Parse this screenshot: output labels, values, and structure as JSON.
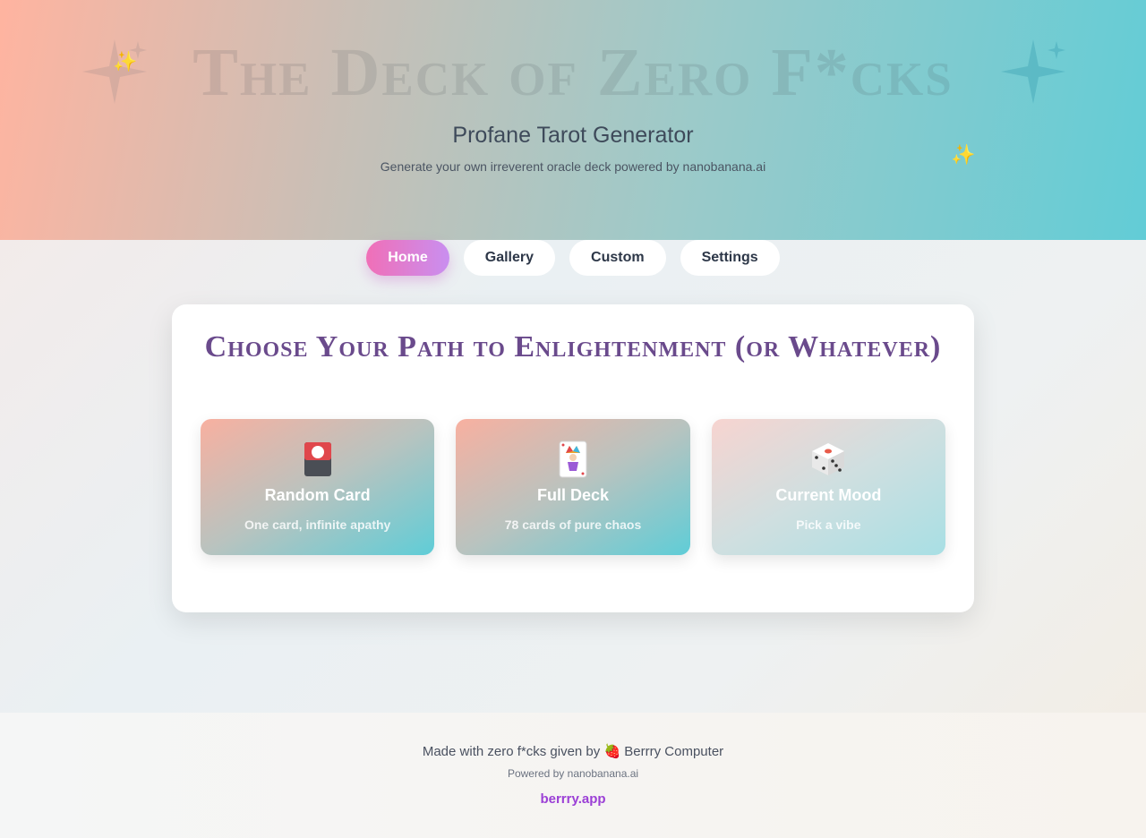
{
  "hero": {
    "title": "The Deck of Zero F*cks",
    "subtitle": "Profane Tarot Generator",
    "tagline": "Generate your own irreverent oracle deck powered by nanobanana.ai"
  },
  "nav": {
    "items": [
      {
        "label": "Home",
        "active": true
      },
      {
        "label": "Gallery",
        "active": false
      },
      {
        "label": "Custom",
        "active": false
      },
      {
        "label": "Settings",
        "active": false
      }
    ]
  },
  "main": {
    "heading": "Choose Your Path to Enlightenment (or Whatever)",
    "options": [
      {
        "title": "Random Card",
        "description": "One card, infinite apathy",
        "icon": "flower-card-icon"
      },
      {
        "title": "Full Deck",
        "description": "78 cards of pure chaos",
        "icon": "joker-card-icon"
      },
      {
        "title": "Current Mood",
        "description": "Pick a vibe",
        "icon": "dice-icon"
      }
    ]
  },
  "footer": {
    "credit_prefix": "Made with zero f*cks given by",
    "credit_icon": "strawberry-icon",
    "credit_name": "Berrry Computer",
    "powered_by": "Powered by nanobanana.ai",
    "link": "berrry.app"
  },
  "colors": {
    "accent_pink": "#f06fb7",
    "accent_purple": "#c98ff0",
    "heading_purple": "#6a4a8c",
    "link_purple": "#9b3fd6",
    "hero_start": "#ffb4a0",
    "hero_end": "#62ccd6"
  }
}
